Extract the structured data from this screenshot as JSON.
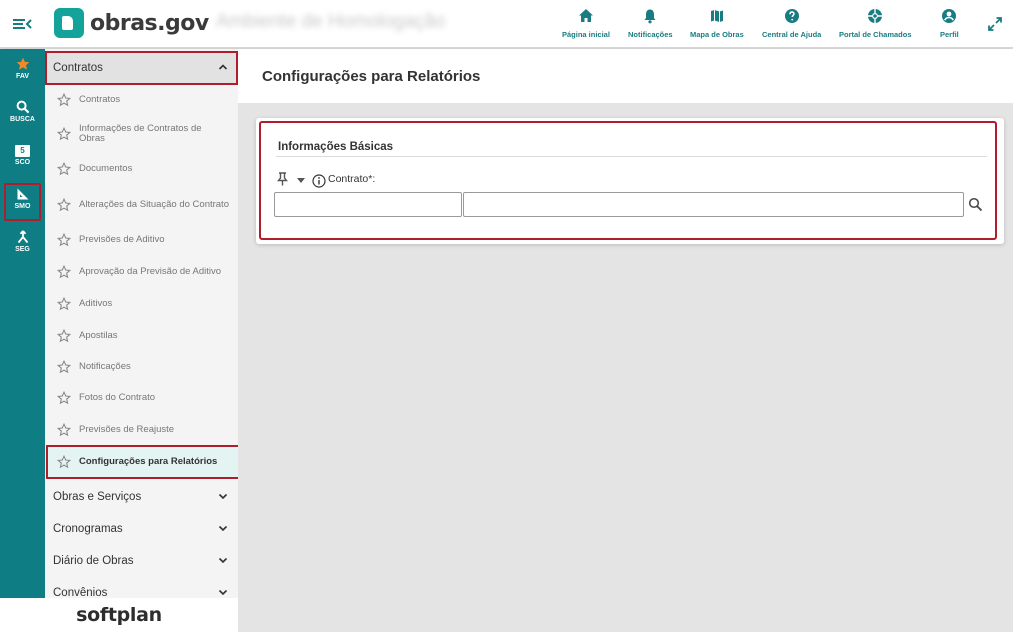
{
  "header": {
    "logo_text": "obras.gov",
    "environment": "Ambiente de Homologação",
    "nav": [
      {
        "label": "Página inicial",
        "icon": "home-icon"
      },
      {
        "label": "Notificações",
        "icon": "bell-icon"
      },
      {
        "label": "Mapa de Obras",
        "icon": "map-icon"
      },
      {
        "label": "Central de Ajuda",
        "icon": "help-icon"
      },
      {
        "label": "Portal de Chamados",
        "icon": "lifebuoy-icon"
      },
      {
        "label": "Perfil",
        "icon": "user-icon"
      }
    ]
  },
  "rail": {
    "items": [
      {
        "label": "FAV",
        "icon": "star-icon"
      },
      {
        "label": "BUSCA",
        "icon": "search-icon"
      },
      {
        "label": "SCO",
        "badge": "5"
      },
      {
        "label": "SMO",
        "icon": "ruler-icon",
        "selected": true
      },
      {
        "label": "SEG",
        "icon": "merge-icon"
      }
    ]
  },
  "menu": {
    "open_group": "Contratos",
    "items": [
      "Contratos",
      "Informações de Contratos de Obras",
      "Documentos",
      "Alterações da Situação do Contrato",
      "Previsões de Aditivo",
      "Aprovação da Previsão de Aditivo",
      "Aditivos",
      "Apostilas",
      "Notificações",
      "Fotos do Contrato",
      "Previsões de Reajuste",
      "Configurações para Relatórios"
    ],
    "active_item": "Configurações para Relatórios",
    "groups": [
      "Obras e Serviços",
      "Cronogramas",
      "Diário de Obras",
      "Convênios"
    ]
  },
  "footer_brand": "softplan",
  "main": {
    "title": "Configurações para Relatórios",
    "section_title": "Informações Básicas",
    "field_label": "Contrato*:",
    "contract_code_value": "",
    "contract_name_value": ""
  },
  "colors": {
    "brand_teal": "#0f7d84",
    "logo_teal": "#13a39a",
    "nav_label": "#1a7c83",
    "highlight_red": "#b01e2b",
    "fav_star": "#f08a24"
  }
}
